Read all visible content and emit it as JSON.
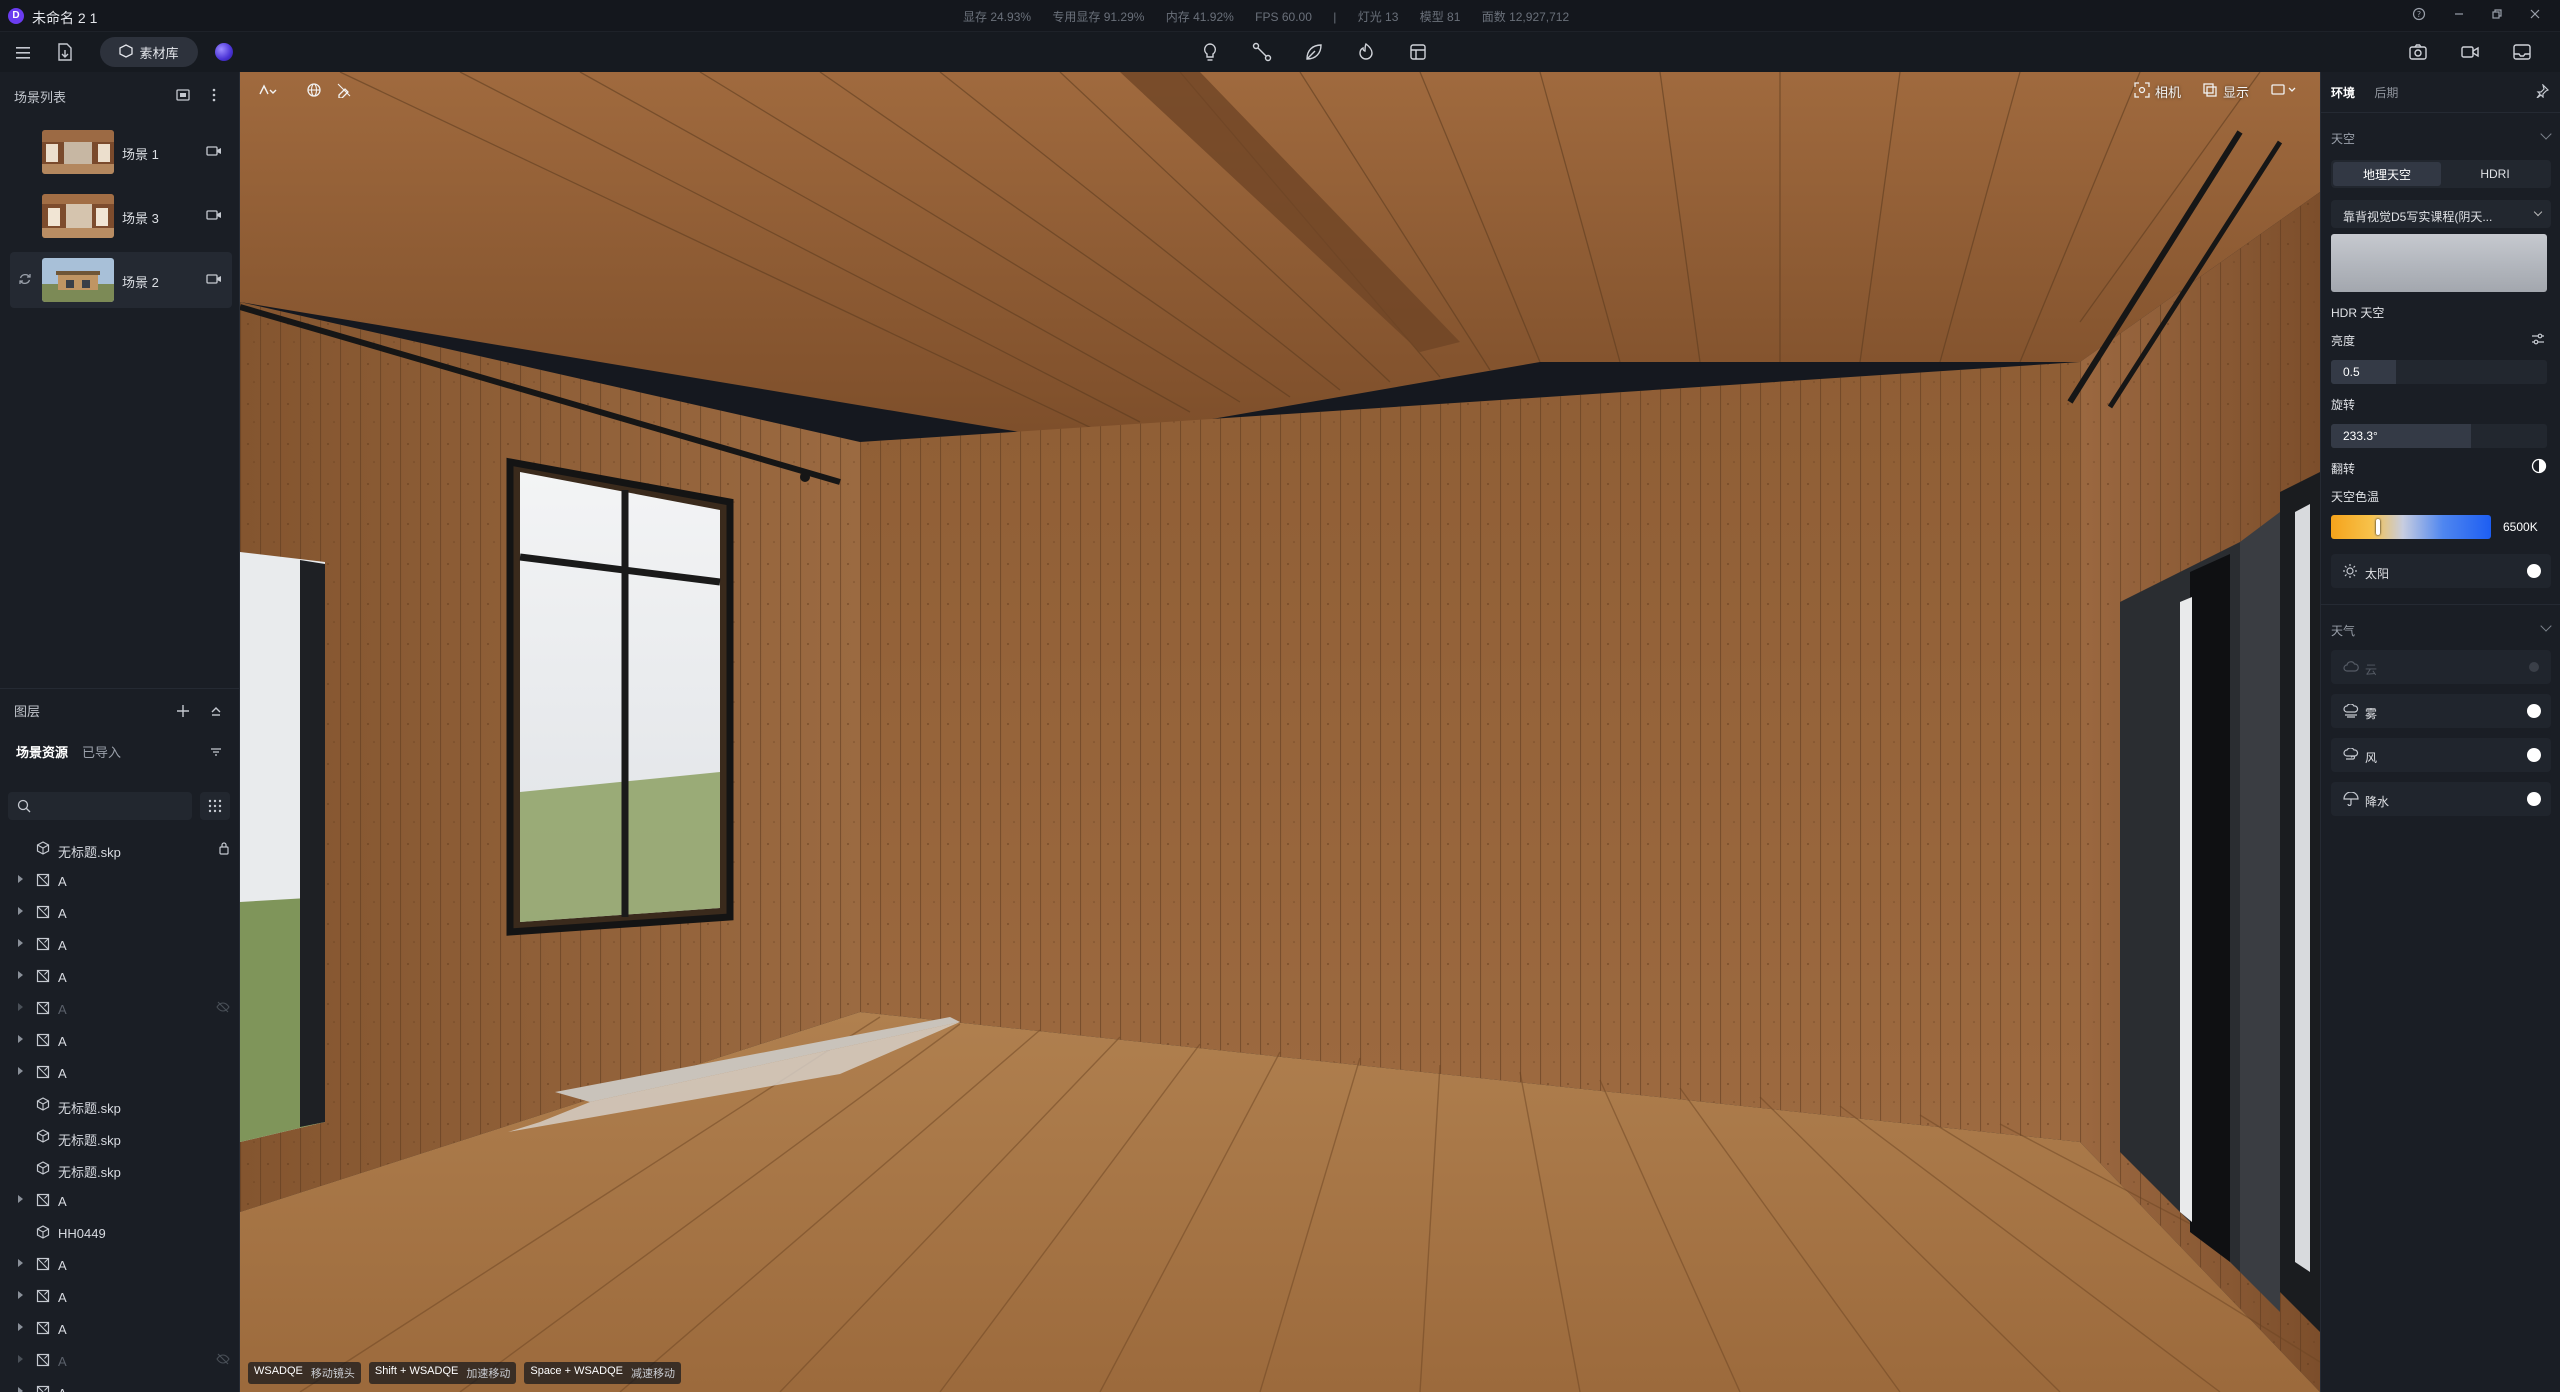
{
  "app": {
    "title": "未命名 2 1",
    "logo": "D"
  },
  "stats": [
    "显存 24.93%",
    "专用显存 91.29%",
    "内存 41.92%",
    "FPS 60.00",
    "|",
    "灯光 13",
    "模型 81",
    "面数 12,927,712"
  ],
  "toolbar": {
    "assets_label": "素材库"
  },
  "scenes": {
    "header": "场景列表",
    "items": [
      {
        "label": "场景 1"
      },
      {
        "label": "场景 3"
      },
      {
        "label": "场景 2"
      }
    ]
  },
  "layers": {
    "header": "图层",
    "tab_active": "场景资源",
    "tab_other": "已导入",
    "search_placeholder": ""
  },
  "tree": [
    {
      "label": "无标题.skp",
      "type": "model",
      "arrow": false,
      "lock": true,
      "dim": false
    },
    {
      "label": "A",
      "type": "group",
      "arrow": true,
      "dim": false
    },
    {
      "label": "A",
      "type": "group",
      "arrow": true,
      "dim": false
    },
    {
      "label": "A",
      "type": "group",
      "arrow": true,
      "dim": false
    },
    {
      "label": "A",
      "type": "group",
      "arrow": true,
      "dim": false
    },
    {
      "label": "A",
      "type": "group",
      "arrow": true,
      "dim": true,
      "hidden": true
    },
    {
      "label": "A",
      "type": "group",
      "arrow": true,
      "dim": false
    },
    {
      "label": "A",
      "type": "group",
      "arrow": true,
      "dim": false
    },
    {
      "label": "无标题.skp",
      "type": "model",
      "arrow": false,
      "dim": false
    },
    {
      "label": "无标题.skp",
      "type": "model",
      "arrow": false,
      "dim": false
    },
    {
      "label": "无标题.skp",
      "type": "model",
      "arrow": false,
      "dim": false
    },
    {
      "label": "A",
      "type": "group",
      "arrow": true,
      "dim": false
    },
    {
      "label": "HH0449",
      "type": "model",
      "arrow": false,
      "dim": false
    },
    {
      "label": "A",
      "type": "group",
      "arrow": true,
      "dim": false
    },
    {
      "label": "A",
      "type": "group",
      "arrow": true,
      "dim": false
    },
    {
      "label": "A",
      "type": "group",
      "arrow": true,
      "dim": false
    },
    {
      "label": "A",
      "type": "group",
      "arrow": true,
      "dim": true,
      "hidden": true
    },
    {
      "label": "A",
      "type": "group",
      "arrow": true,
      "dim": false
    }
  ],
  "viewport": {
    "camera_label": "相机",
    "display_label": "显示",
    "hints": [
      {
        "key": "WSADQE",
        "action": "移动镜头"
      },
      {
        "key": "Shift + WSADQE",
        "action": "加速移动"
      },
      {
        "key": "Space + WSADQE",
        "action": "减速移动"
      }
    ]
  },
  "right": {
    "tab_env": "环境",
    "tab_post": "后期",
    "sky_header": "天空",
    "sky_mode_geo": "地理天空",
    "sky_mode_hdri": "HDRI",
    "preset": "靠背视觉D5写实课程(阴天...",
    "hdr_label": "HDR 天空",
    "brightness_label": "亮度",
    "brightness": "0.5",
    "brightness_frac": 0.3,
    "rotation_label": "旋转",
    "rotation": "233.3°",
    "rotation_frac": 0.65,
    "flip_label": "翻转",
    "color_temp_label": "天空色温",
    "color_temp": "6500K",
    "color_temp_frac": 0.28,
    "sun_label": "太阳",
    "weather_header": "天气",
    "weather": [
      {
        "label": "云",
        "dim": true
      },
      {
        "label": "雾",
        "dim": false
      },
      {
        "label": "风",
        "dim": false
      },
      {
        "label": "降水",
        "dim": false
      }
    ]
  }
}
